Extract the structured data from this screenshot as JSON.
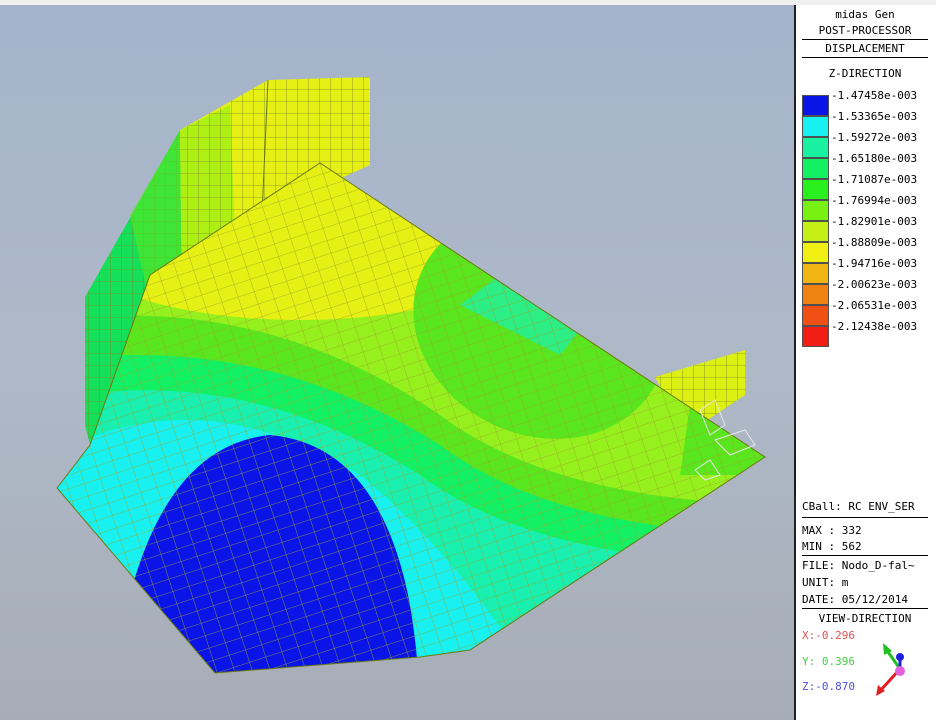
{
  "panel": {
    "program": "midas Gen",
    "mode": "POST-PROCESSOR",
    "result_type": "DISPLACEMENT",
    "direction": "Z-DIRECTION",
    "legend": [
      {
        "value": "-1.47458e-003",
        "color": "#0a14e6"
      },
      {
        "value": "-1.53365e-003",
        "color": "#19f0f0"
      },
      {
        "value": "-1.59272e-003",
        "color": "#19f0a0"
      },
      {
        "value": "-1.65180e-003",
        "color": "#14f064"
      },
      {
        "value": "-1.71087e-003",
        "color": "#2af01e"
      },
      {
        "value": "-1.76994e-003",
        "color": "#78f014"
      },
      {
        "value": "-1.82901e-003",
        "color": "#c4f014"
      },
      {
        "value": "-1.88809e-003",
        "color": "#f0f014"
      },
      {
        "value": "-1.94716e-003",
        "color": "#f0b414"
      },
      {
        "value": "-2.00623e-003",
        "color": "#f08214"
      },
      {
        "value": "-2.06531e-003",
        "color": "#f05014"
      },
      {
        "value": "-2.12438e-003",
        "color": "#f01e14"
      }
    ],
    "load_case": "CBall: RC ENV_SER",
    "max": "MAX : 332",
    "min": "MIN : 562",
    "file": "FILE: Nodo_D-fal~",
    "unit": "UNIT: m",
    "date": "DATE: 05/12/2014",
    "view_direction_label": "VIEW-DIRECTION",
    "view_x": "X:-0.296",
    "view_y": "Y: 0.396",
    "view_z": "Z:-0.870",
    "axis_colors": {
      "x": "#e05050",
      "y": "#40d040",
      "z": "#5050e0"
    }
  }
}
